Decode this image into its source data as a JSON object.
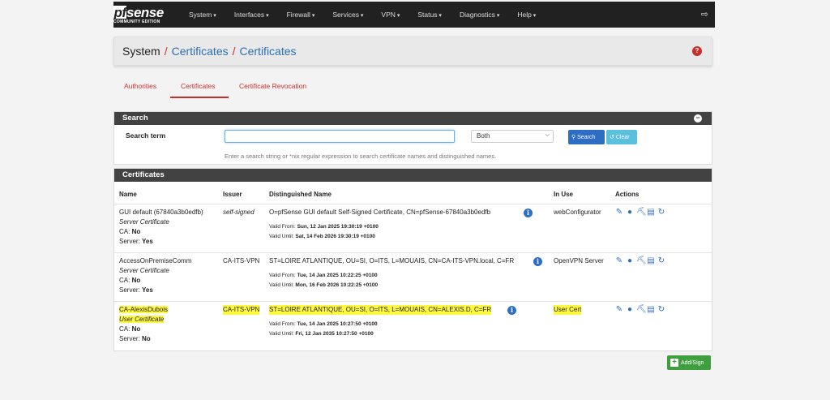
{
  "brand": {
    "main_prefix": "pf",
    "main_suffix": "sense",
    "sub": "COMMUNITY EDITION"
  },
  "navbar": {
    "items": [
      "System",
      "Interfaces",
      "Firewall",
      "Services",
      "VPN",
      "Status",
      "Diagnostics",
      "Help"
    ]
  },
  "breadcrumb": {
    "root": "System",
    "sep": "/",
    "level1": "Certificates",
    "level2": "Certificates"
  },
  "tabs": [
    "Authorities",
    "Certificates",
    "Certificate Revocation"
  ],
  "search": {
    "heading": "Search",
    "label": "Search term",
    "value": "",
    "scope": "Both",
    "search_button": "Search",
    "clear_button": "Clear",
    "help": "Enter a search string or *nix regular expression to search certificate names and distinguished names."
  },
  "certificates": {
    "heading": "Certificates",
    "columns": [
      "Name",
      "Issuer",
      "Distinguished Name",
      "In Use",
      "Actions"
    ],
    "rows": [
      {
        "name": "GUI default (67840a3b0edfb)",
        "type": "Server Certificate",
        "ca_label": "CA:",
        "ca": "No",
        "server_label": "Server:",
        "server": "Yes",
        "issuer": "self-signed",
        "dn": "O=pfSense GUI default Self-Signed Certificate, CN=pfSense-67840a3b0edfb",
        "valid_from_label": "Valid From:",
        "valid_from": "Sun, 12 Jan 2025 19:30:19 +0100",
        "valid_until_label": "Valid Until:",
        "valid_until": "Sat, 14 Feb 2026 19:30:19 +0100",
        "in_use": "webConfigurator"
      },
      {
        "name": "AccessOnPremiseComm",
        "type": "Server Certificate",
        "ca_label": "CA:",
        "ca": "No",
        "server_label": "Server:",
        "server": "Yes",
        "issuer": "CA-ITS-VPN",
        "dn": "ST=LOIRE ATLANTIQUE, OU=SI, O=ITS, L=MOUAIS, CN=CA-ITS-VPN.local, C=FR",
        "valid_from_label": "Valid From:",
        "valid_from": "Tue, 14 Jan 2025 10:22:25 +0100",
        "valid_until_label": "Valid Until:",
        "valid_until": "Mon, 16 Feb 2026 10:22:25 +0100",
        "in_use": "OpenVPN Server"
      },
      {
        "name": "CA-AlexisDubois",
        "type": "User Certificate",
        "ca_label": "CA:",
        "ca": "No",
        "server_label": "Server:",
        "server": "No",
        "issuer": "CA-ITS-VPN",
        "dn": "ST=LOIRE ATLANTIQUE, OU=SI, O=ITS, L=MOUAIS, CN=ALEXIS.D, C=FR",
        "valid_from_label": "Valid From:",
        "valid_from": "Tue, 14 Jan 2025 10:27:50 +0100",
        "valid_until_label": "Valid Until:",
        "valid_until": "Fri, 12 Jan 2035 10:27:50 +0100",
        "in_use": "User Cert"
      }
    ]
  },
  "add_button": "Add/Sign",
  "colors": {
    "navbar": "#212121",
    "accent": "#c9302c",
    "link": "#2e6fb4",
    "primary": "#2d6ec4",
    "success": "#3f9f3f",
    "highlight": "#fff500"
  }
}
